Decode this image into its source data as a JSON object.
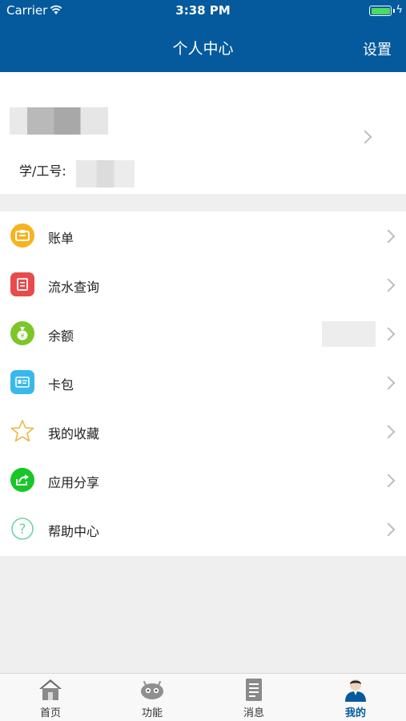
{
  "status_bar": {
    "carrier": "Carrier",
    "time": "3:38 PM",
    "charging_symbol": "ϟ"
  },
  "header": {
    "title": "个人中心",
    "settings_label": "设置"
  },
  "profile": {
    "id_label": "学/工号:"
  },
  "menu": [
    {
      "label": "账单",
      "icon": "bill-icon",
      "color": "#f6b320"
    },
    {
      "label": "流水查询",
      "icon": "transaction-icon",
      "color": "#e84b4b"
    },
    {
      "label": "余额",
      "icon": "money-bag-icon",
      "color": "#7cc627"
    },
    {
      "label": "卡包",
      "icon": "card-wallet-icon",
      "color": "#38b8ec"
    },
    {
      "label": "我的收藏",
      "icon": "star-icon",
      "color": "#e8b845"
    },
    {
      "label": "应用分享",
      "icon": "share-icon",
      "color": "#17c627"
    },
    {
      "label": "帮助中心",
      "icon": "help-icon",
      "color": "#6fd3a8"
    }
  ],
  "tabbar": [
    {
      "label": "首页",
      "icon": "home-icon"
    },
    {
      "label": "功能",
      "icon": "robot-icon"
    },
    {
      "label": "消息",
      "icon": "document-icon"
    },
    {
      "label": "我的",
      "icon": "person-icon",
      "active": true
    }
  ],
  "colors": {
    "header": "#045a9d",
    "active_tab": "#045a9d"
  }
}
